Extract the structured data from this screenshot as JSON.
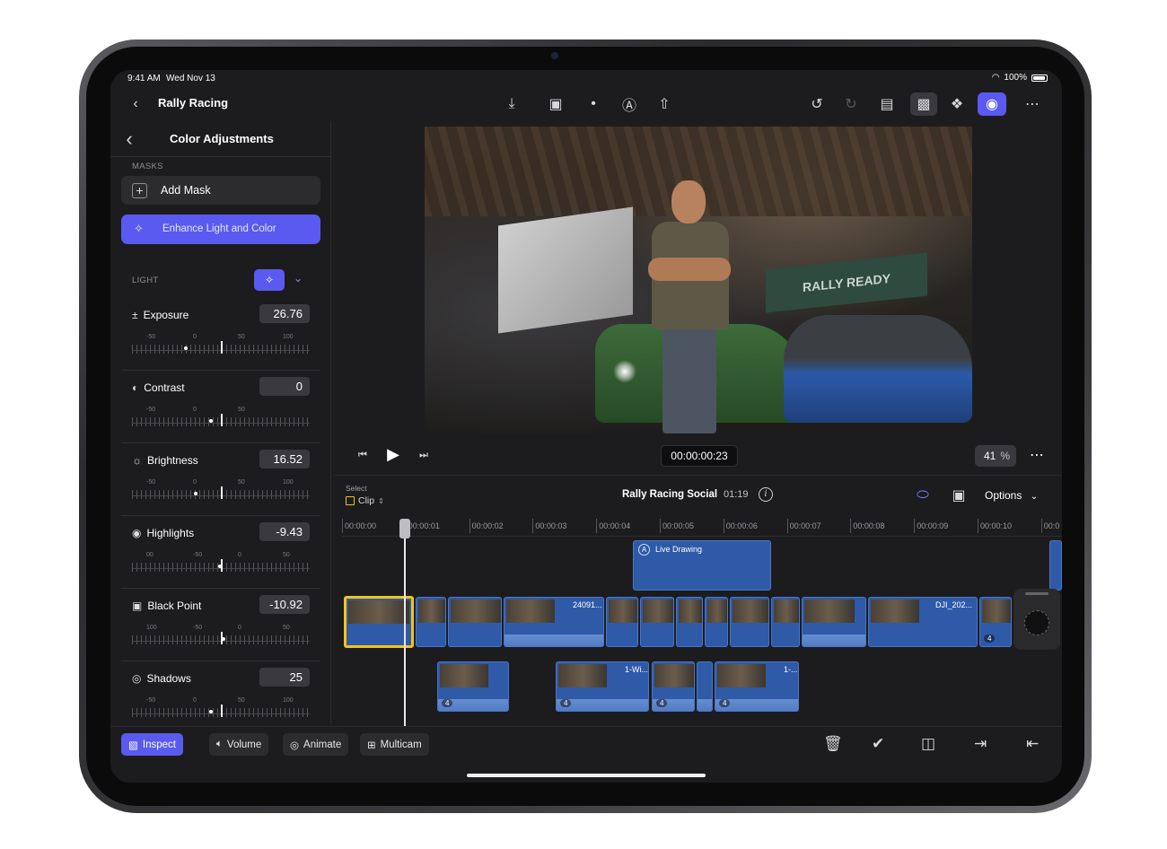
{
  "status": {
    "time": "9:41 AM",
    "date": "Wed Nov 13",
    "battery": "100%"
  },
  "nav": {
    "title": "Rally Racing"
  },
  "panel": {
    "title": "Color Adjustments",
    "masks_label": "MASKS",
    "add_mask": "Add Mask",
    "enhance": "Enhance Light and Color",
    "light_label": "LIGHT"
  },
  "adjustments": [
    {
      "name": "Exposure",
      "icon": "plus-minus-icon",
      "value": "26.76",
      "ticks": [
        "-50",
        "0",
        "50",
        "100"
      ]
    },
    {
      "name": "Contrast",
      "icon": "contrast-icon",
      "value": "0",
      "ticks": [
        "-50",
        "0",
        "50"
      ]
    },
    {
      "name": "Brightness",
      "icon": "sun-icon",
      "value": "16.52",
      "ticks": [
        "-50",
        "0",
        "50",
        "100"
      ]
    },
    {
      "name": "Highlights",
      "icon": "highlights-icon",
      "value": "-9.43",
      "ticks": [
        "00",
        "-50",
        "0",
        "50"
      ]
    },
    {
      "name": "Black Point",
      "icon": "black-point-icon",
      "value": "-10.92",
      "ticks": [
        "100",
        "-50",
        "0",
        "50"
      ]
    },
    {
      "name": "Shadows",
      "icon": "shadows-icon",
      "value": "25",
      "ticks": [
        "-50",
        "0",
        "50",
        "100"
      ]
    }
  ],
  "viewer": {
    "timecode": "00:00:00:23",
    "zoom": "41",
    "zoom_unit": "%",
    "banner_text": "RALLY READY"
  },
  "timeline": {
    "select_label": "Select",
    "clip_label": "Clip",
    "project_name": "Rally Racing Social",
    "duration": "01:19",
    "options_label": "Options",
    "ruler": [
      "00:00:00",
      "00:00:01",
      "00:00:02",
      "00:00:03",
      "00:00:04",
      "00:00:05",
      "00:00:06",
      "00:00:07",
      "00:00:08",
      "00:00:09",
      "00:00:10",
      "00:0"
    ],
    "title_clip": "Live Drawing",
    "clip_names": [
      "24091...",
      "DJI_202...",
      "1-Wi...",
      "1-..."
    ],
    "badge_count": "4"
  },
  "toolbar": {
    "inspect": "Inspect",
    "volume": "Volume",
    "animate": "Animate",
    "multicam": "Multicam"
  },
  "colors": {
    "accent": "#5a5af0",
    "clip": "#2f5aa8",
    "selection": "#f2c418"
  }
}
